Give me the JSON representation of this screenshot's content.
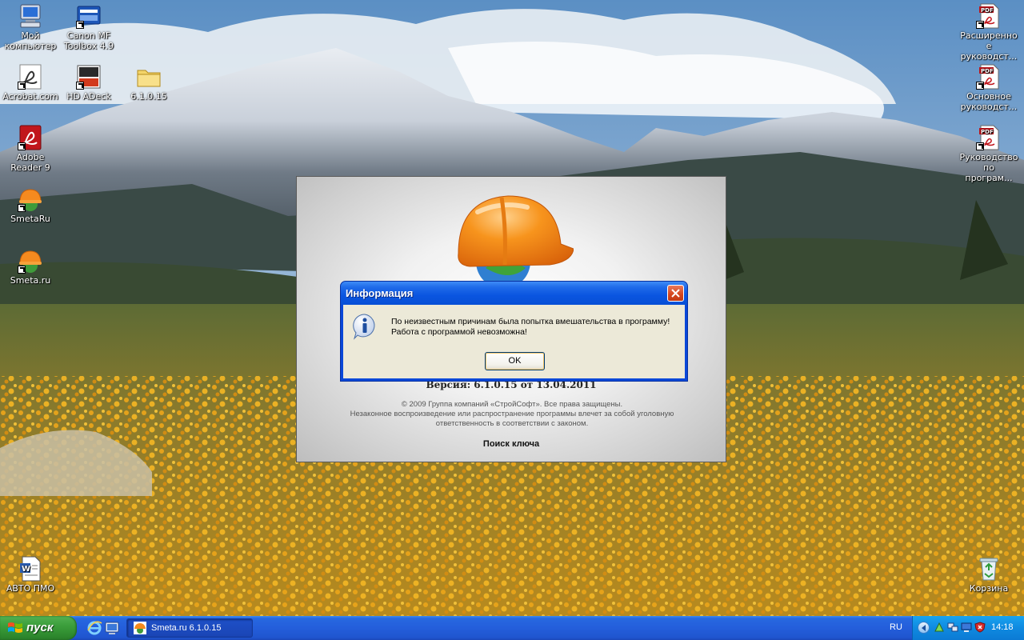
{
  "desktop": {
    "icons": [
      {
        "label": "Мой компьютер",
        "icon": "computer-icon"
      },
      {
        "label": "Canon MF Toolbox 4.9",
        "icon": "scanner-app-icon"
      },
      {
        "label": "Acrobat.com",
        "icon": "acrobat-icon"
      },
      {
        "label": "HD ADeck",
        "icon": "hd-adeck-icon"
      },
      {
        "label": "6.1.0.15",
        "icon": "folder-icon"
      },
      {
        "label": "Adobe Reader 9",
        "icon": "adobe-reader-icon"
      },
      {
        "label": "SmetaRu",
        "icon": "smeta-helmet-icon"
      },
      {
        "label": "Smeta.ru",
        "icon": "smeta-helmet-icon"
      },
      {
        "label": "АВТО ПМО",
        "icon": "word-document-icon"
      },
      {
        "label": "Расширенное руководст...",
        "icon": "pdf-icon"
      },
      {
        "label": "Основное руководст...",
        "icon": "pdf-icon"
      },
      {
        "label": "Руководство по програм...",
        "icon": "pdf-icon"
      },
      {
        "label": "Корзина",
        "icon": "recycle-bin-icon"
      }
    ]
  },
  "splash": {
    "version": "Версия: 6.1.0.15 от 13.04.2011",
    "copyright_lines": [
      "© 2009 Группа компаний «СтройСофт». Все права защищены.",
      "Незаконное воспроизведение или распространение программы влечет за собой уголовную",
      "ответственность в соответствии с законом."
    ],
    "key_search": "Поиск ключа"
  },
  "dialog": {
    "title": "Информация",
    "message_lines": [
      "По неизвестным причинам была попытка вмешательства в программу!",
      "Работа с программой невозможна!"
    ],
    "ok_label": "OK"
  },
  "taskbar": {
    "start_label": "пуск",
    "tasks": [
      {
        "label": "Smeta.ru  6.1.0.15"
      }
    ],
    "language": "RU",
    "clock": "14:18"
  },
  "colors": {
    "taskbar_blue": "#245edb",
    "start_green": "#3c9e3c",
    "dialog_face": "#ece9d8",
    "title_blue": "#0a55e0"
  }
}
